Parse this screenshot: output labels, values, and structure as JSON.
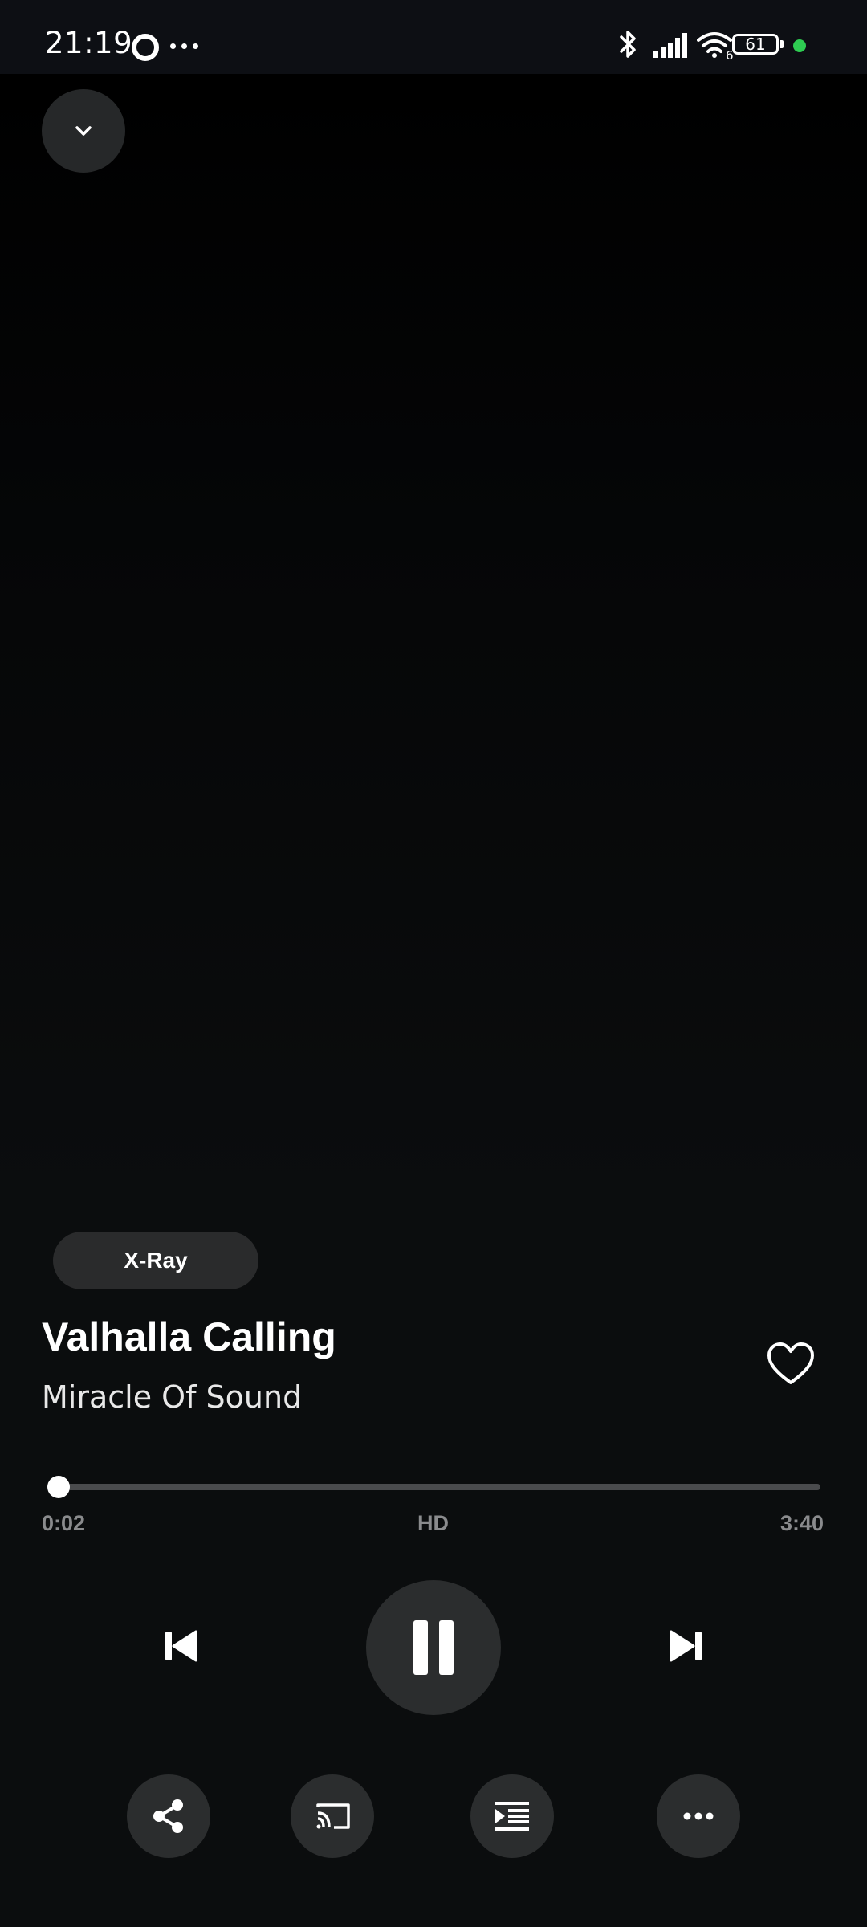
{
  "status_bar": {
    "time": "21:19",
    "battery": "61",
    "wifi_label": "6",
    "icons": [
      "ring-icon",
      "dots-icon",
      "bluetooth-icon",
      "signal-icon",
      "wifi-icon",
      "battery-icon"
    ],
    "indicator_color": "#2ecc52"
  },
  "player": {
    "collapse_icon": "chevron-down-icon",
    "xray_label": "X-Ray",
    "title": "Valhalla Calling",
    "artist": "Miracle Of Sound",
    "favorite_icon": "heart-outline-icon",
    "elapsed": "0:02",
    "quality": "HD",
    "duration": "3:40",
    "progress_fraction": 0.009
  },
  "controls": {
    "previous_icon": "skip-previous-icon",
    "pause_icon": "pause-icon",
    "next_icon": "skip-next-icon"
  },
  "actions": {
    "share_icon": "share-icon",
    "cast_icon": "cast-icon",
    "queue_icon": "queue-icon",
    "more_icon": "more-horizontal-icon"
  },
  "colors": {
    "background": "#0b0d0e",
    "button_bg": "#2b2d2e",
    "muted_text": "#8a8b8d",
    "track_bg": "#4a4b4d"
  }
}
